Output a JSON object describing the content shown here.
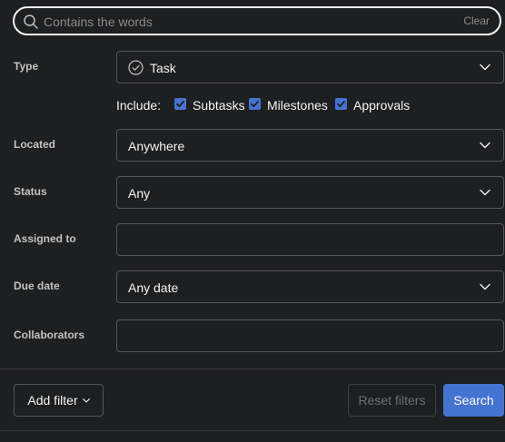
{
  "search": {
    "placeholder": "Contains the words",
    "value": "",
    "clear_label": "Clear"
  },
  "type": {
    "label": "Type",
    "value": "Task",
    "icon": "check-circle-icon"
  },
  "include": {
    "label": "Include:",
    "options": [
      {
        "label": "Subtasks",
        "checked": true
      },
      {
        "label": "Milestones",
        "checked": true
      },
      {
        "label": "Approvals",
        "checked": true
      }
    ]
  },
  "located": {
    "label": "Located",
    "value": "Anywhere"
  },
  "status": {
    "label": "Status",
    "value": "Any"
  },
  "assigned_to": {
    "label": "Assigned to",
    "value": ""
  },
  "due_date": {
    "label": "Due date",
    "value": "Any date"
  },
  "collaborators": {
    "label": "Collaborators",
    "value": ""
  },
  "footer": {
    "add_filter_label": "Add filter",
    "reset_label": "Reset filters",
    "search_label": "Search"
  },
  "colors": {
    "background": "#1e1f21",
    "accent": "#4573d2",
    "checkbox": "#4573d2",
    "border": "#565557"
  }
}
